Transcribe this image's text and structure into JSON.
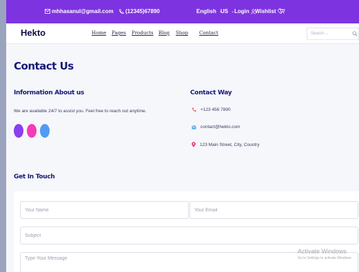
{
  "topbar": {
    "email": "mhhasanul@gmail.com",
    "phone": "(12345)67890",
    "language": "English",
    "currency": "USD",
    "currency_short": "US",
    "login": "Login",
    "wishlist": "Wishlist"
  },
  "nav": {
    "logo": "Hekto",
    "links": [
      "Home",
      "Pages",
      "Products",
      "Blog",
      "Shop",
      "Contact"
    ],
    "search_placeholder": "Search ..."
  },
  "page": {
    "title": "Contact Us",
    "info_heading": "Information About us",
    "info_text": "We are available 24/7 to assist you. Feel free to reach out anytime.",
    "dot_colors": [
      "#8b3ff0",
      "#f43bb8",
      "#4f9bf5"
    ],
    "contact_heading": "Contact Way",
    "contact_phone": "+123 456 7890",
    "contact_email": "contact@hekto.com",
    "contact_address": "123 Main Street, City, Country",
    "form_heading": "Get In Touch"
  },
  "form": {
    "name_placeholder": "Your Name",
    "email_placeholder": "Your Email",
    "subject_placeholder": "Subject",
    "message_placeholder": "Type Your Message"
  },
  "watermark": {
    "title": "Activate Windows",
    "subtitle": "Go to Settings to activate Windows."
  },
  "colors": {
    "topbar": "#7e33e0",
    "heading": "#151875",
    "phone_icon": "#e8443a",
    "email_icon": "#5ab0f0",
    "address_icon": "#f0397a"
  }
}
